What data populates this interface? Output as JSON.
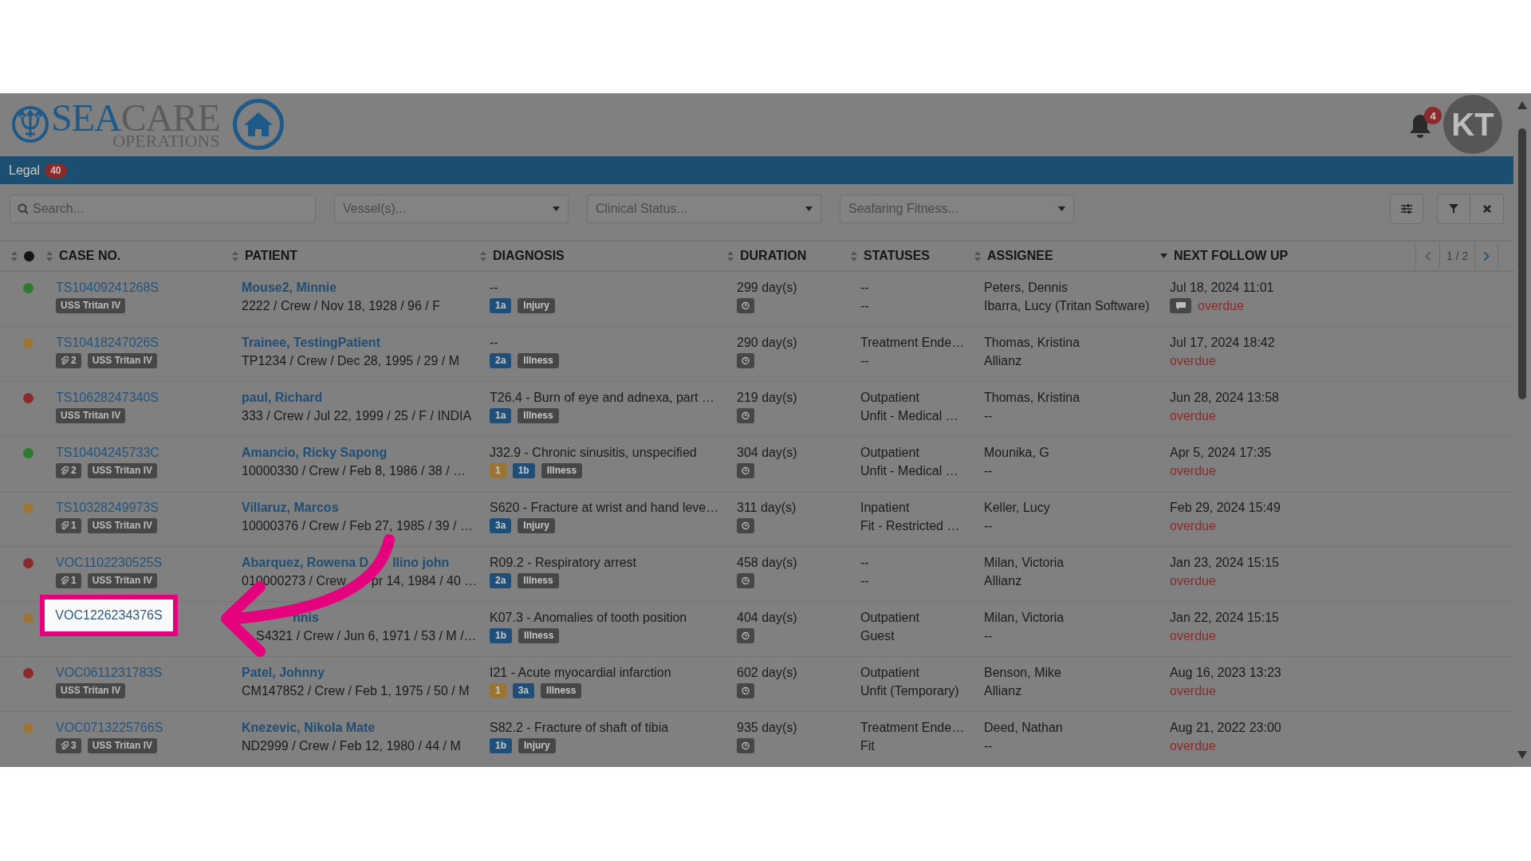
{
  "logo": {
    "word1": "SEA",
    "word2": "CARE",
    "subtitle": "OPERATIONS"
  },
  "notifications": {
    "count": "4"
  },
  "avatar": {
    "initials": "KT"
  },
  "nav": [
    {
      "label": "Legal",
      "count": "40"
    }
  ],
  "filters": {
    "search": {
      "placeholder": "Search..."
    },
    "dropdowns": [
      {
        "placeholder": "Vessel(s)..."
      },
      {
        "placeholder": "Clinical Status..."
      },
      {
        "placeholder": "Seafaring Fitness..."
      }
    ]
  },
  "table": {
    "columns": [
      {
        "label": "CASE NO.",
        "sorted": false
      },
      {
        "label": "PATIENT",
        "sorted": false
      },
      {
        "label": "DIAGNOSIS",
        "sorted": false
      },
      {
        "label": "DURATION",
        "sorted": false
      },
      {
        "label": "STATUSES",
        "sorted": false
      },
      {
        "label": "ASSIGNEE",
        "sorted": false
      },
      {
        "label": "NEXT FOLLOW UP",
        "sorted": true
      }
    ],
    "pager": {
      "text": "1 / 2"
    },
    "rows": [
      {
        "color": "#2e7a2e",
        "case_no": "TS10409241268S",
        "tags": [
          {
            "kind": "vessel",
            "text": "USS Tritan IV"
          }
        ],
        "covered": false,
        "patient": [
          "Mouse2, Minnie"
        ],
        "detail": [
          "2222 / Crew / Nov 18, 1928 / 96 / F"
        ],
        "diagnosis": "--",
        "badges": [
          {
            "text": "1a",
            "color": "#1f4f78"
          },
          {
            "text": "Injury",
            "color": "#474747"
          }
        ],
        "duration": "299 day(s)",
        "status": [
          "--",
          "--"
        ],
        "assignee": [
          "Peters, Dennis",
          "Ibarra, Lucy (Tritan Software)"
        ],
        "follow_up": "Jul 18, 2024 11:01",
        "comment": true,
        "note": "overdue"
      },
      {
        "color": "#9c7434",
        "case_no": "TS10418247026S",
        "tags": [
          {
            "kind": "attachment",
            "text": "2"
          },
          {
            "kind": "vessel",
            "text": "USS Tritan IV"
          }
        ],
        "covered": false,
        "patient": [
          "Trainee, TestingPatient"
        ],
        "detail": [
          "TP1234 / Crew / Dec 28, 1995 / 29 / M"
        ],
        "diagnosis": "--",
        "badges": [
          {
            "text": "2a",
            "color": "#1f4f78"
          },
          {
            "text": "Illness",
            "color": "#474747"
          }
        ],
        "duration": "290 day(s)",
        "status": [
          "Treatment Ende…",
          "--"
        ],
        "assignee": [
          "Thomas, Kristina",
          "Allianz"
        ],
        "follow_up": "Jul 17, 2024 18:42",
        "comment": false,
        "note": "overdue"
      },
      {
        "color": "#8b2a2a",
        "case_no": "TS10628247340S",
        "tags": [
          {
            "kind": "vessel",
            "text": "USS Tritan IV"
          }
        ],
        "covered": false,
        "patient": [
          "paul, Richard"
        ],
        "detail": [
          "333 / Crew / Jul 22, 1999 / 25 / F / INDIA"
        ],
        "diagnosis": "T26.4 - Burn of eye and adnexa, part …",
        "badges": [
          {
            "text": "1a",
            "color": "#1f4f78"
          },
          {
            "text": "Illness",
            "color": "#474747"
          }
        ],
        "duration": "219 day(s)",
        "status": [
          "Outpatient",
          "Unfit - Medical …"
        ],
        "assignee": [
          "Thomas, Kristina",
          "--"
        ],
        "follow_up": "Jun 28, 2024 13:58",
        "comment": false,
        "note": "overdue"
      },
      {
        "color": "#2e7a2e",
        "case_no": "TS10404245733C",
        "tags": [
          {
            "kind": "attachment",
            "text": "2"
          },
          {
            "kind": "vessel",
            "text": "USS Tritan IV"
          }
        ],
        "covered": false,
        "patient": [
          "Amancio, Ricky Sapong"
        ],
        "detail": [
          "10000330 / Crew / Feb 8, 1986 / 38 / …"
        ],
        "diagnosis": "J32.9 - Chronic sinusitis, unspecified",
        "badges": [
          {
            "text": "1",
            "color": "#9a7433"
          },
          {
            "text": "1b",
            "color": "#1f4f78"
          },
          {
            "text": "Illness",
            "color": "#474747"
          }
        ],
        "duration": "304 day(s)",
        "status": [
          "Outpatient",
          "Unfit - Medical …"
        ],
        "assignee": [
          "Mounika, G",
          "--"
        ],
        "follow_up": "Apr 5, 2024 17:35",
        "comment": false,
        "note": "overdue"
      },
      {
        "color": "#9c7434",
        "case_no": "TS10328249973S",
        "tags": [
          {
            "kind": "attachment",
            "text": "1"
          },
          {
            "kind": "vessel",
            "text": "USS Tritan IV"
          }
        ],
        "covered": false,
        "patient": [
          "Villaruz, Marcos"
        ],
        "detail": [
          "10000376 / Crew / Feb 27, 1985 / 39 / …"
        ],
        "diagnosis": "S620 - Fracture at wrist and hand leve…",
        "badges": [
          {
            "text": "3a",
            "color": "#1f4f78"
          },
          {
            "text": "Injury",
            "color": "#474747"
          }
        ],
        "duration": "311 day(s)",
        "status": [
          "Inpatient",
          "Fit - Restricted …"
        ],
        "assignee": [
          "Keller, Lucy",
          "--"
        ],
        "follow_up": "Feb 29, 2024 15:49",
        "comment": false,
        "note": "overdue"
      },
      {
        "color": "#8b2a2a",
        "case_no": "VOC1102230525S",
        "tags": [
          {
            "kind": "attachment",
            "text": "1"
          },
          {
            "kind": "vessel",
            "text": "USS Tritan IV"
          }
        ],
        "covered": false,
        "patient": [
          "Abarquez, Rowena D",
          "llino john"
        ],
        "detail": [
          "010000273 / Crew",
          "pr 14, 1984 / 40 …"
        ],
        "diagnosis": "R09.2 - Respiratory arrest",
        "badges": [
          {
            "text": "2a",
            "color": "#1f4f78"
          },
          {
            "text": "Illness",
            "color": "#474747"
          }
        ],
        "duration": "458 day(s)",
        "status": [
          "--",
          "--"
        ],
        "assignee": [
          "Milan, Victoria",
          "Allianz"
        ],
        "follow_up": "Jan 23, 2024 15:15",
        "comment": false,
        "note": "overdue"
      },
      {
        "color": "#9c7434",
        "tags": [],
        "covered": true,
        "patient": [
          "nnis"
        ],
        "detail": [
          "S4321 / Crew / Jun 6, 1971 / 53 / M /…"
        ],
        "diagnosis": "K07.3 - Anomalies of tooth position",
        "badges": [
          {
            "text": "1b",
            "color": "#1f4f78"
          },
          {
            "text": "Illness",
            "color": "#474747"
          }
        ],
        "duration": "404 day(s)",
        "status": [
          "Outpatient",
          "Guest"
        ],
        "assignee": [
          "Milan, Victoria",
          "--"
        ],
        "follow_up": "Jan 22, 2024 15:15",
        "comment": false,
        "note": "overdue"
      },
      {
        "color": "#8b2a2a",
        "case_no": "VOC0611231783S",
        "tags": [
          {
            "kind": "vessel",
            "text": "USS Tritan IV"
          }
        ],
        "covered": false,
        "patient": [
          "Patel, Johnny"
        ],
        "detail": [
          "CM147852 / Crew / Feb 1, 1975 / 50 / M"
        ],
        "diagnosis": "I21 - Acute myocardial infarction",
        "badges": [
          {
            "text": "1",
            "color": "#9a7433"
          },
          {
            "text": "3a",
            "color": "#1f4f78"
          },
          {
            "text": "Illness",
            "color": "#474747"
          }
        ],
        "duration": "602 day(s)",
        "status": [
          "Outpatient",
          "Unfit (Temporary)"
        ],
        "assignee": [
          "Benson, Mike",
          "Allianz"
        ],
        "follow_up": "Aug 16, 2023 13:23",
        "comment": false,
        "note": "overdue"
      },
      {
        "color": "#9c7434",
        "case_no": "VOC0713225766S",
        "tags": [
          {
            "kind": "attachment",
            "text": "3"
          },
          {
            "kind": "vessel",
            "text": "USS Tritan IV"
          }
        ],
        "covered": false,
        "patient": [
          "Knezevic, Nikola Mate"
        ],
        "detail": [
          "ND2999 / Crew / Feb 12, 1980 / 44 / M"
        ],
        "diagnosis": "S82.2 - Fracture of shaft of tibia",
        "badges": [
          {
            "text": "1b",
            "color": "#1f4f78"
          },
          {
            "text": "Injury",
            "color": "#474747"
          }
        ],
        "duration": "935 day(s)",
        "status": [
          "Treatment Ende…",
          "Fit"
        ],
        "assignee": [
          "Deed, Nathan",
          "--"
        ],
        "follow_up": "Aug 21, 2022 23:00",
        "comment": false,
        "note": "overdue"
      }
    ]
  },
  "highlight": {
    "text": "VOC1226234376S"
  }
}
